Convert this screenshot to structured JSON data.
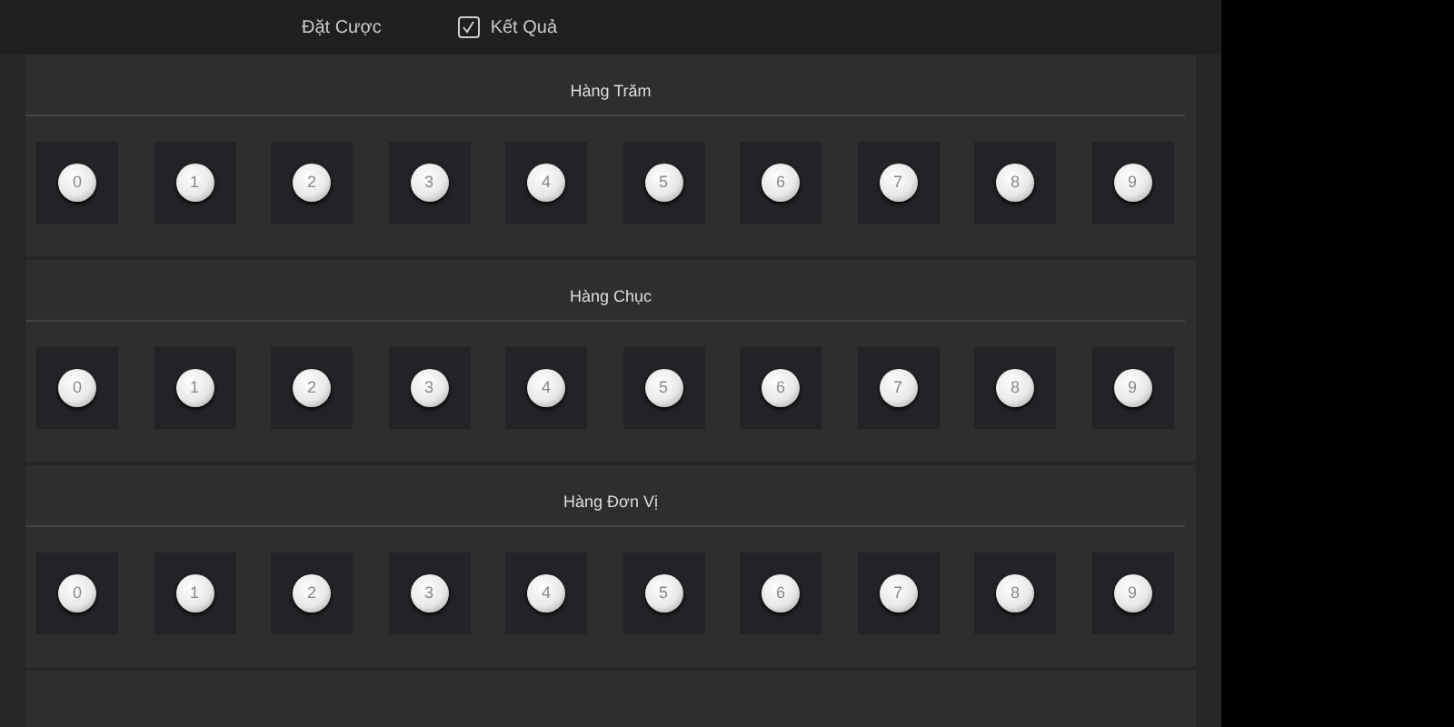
{
  "tabs": [
    {
      "label": "Đặt Cược",
      "kind": "text"
    },
    {
      "label": "Kết Quả",
      "kind": "iconic"
    }
  ],
  "sections": [
    {
      "title": "Hàng Trăm",
      "balls": [
        "0",
        "1",
        "2",
        "3",
        "4",
        "5",
        "6",
        "7",
        "8",
        "9"
      ]
    },
    {
      "title": "Hàng Chục",
      "balls": [
        "0",
        "1",
        "2",
        "3",
        "4",
        "5",
        "6",
        "7",
        "8",
        "9"
      ]
    },
    {
      "title": "Hàng Đơn Vị",
      "balls": [
        "0",
        "1",
        "2",
        "3",
        "4",
        "5",
        "6",
        "7",
        "8",
        "9"
      ]
    }
  ]
}
